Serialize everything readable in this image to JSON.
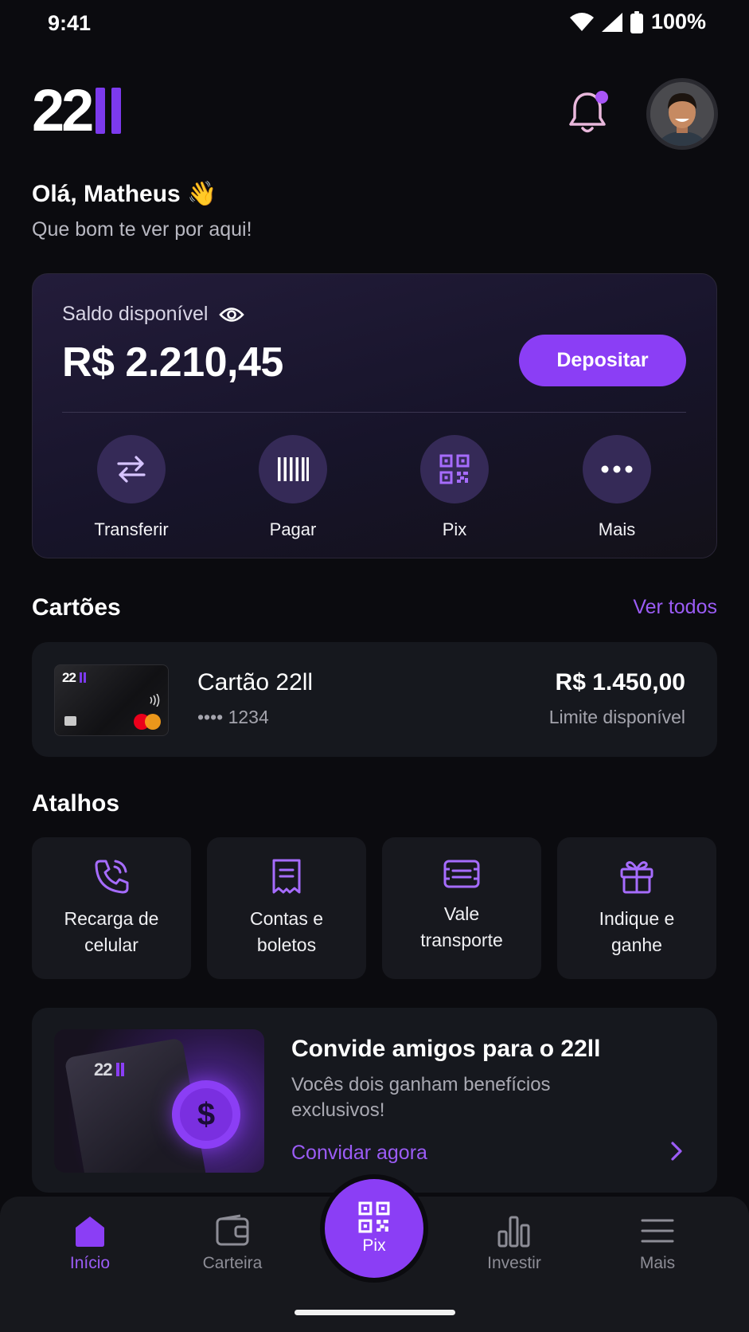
{
  "status_bar": {
    "time": "9:41",
    "battery": "100%"
  },
  "header": {
    "logo_text": "22",
    "greeting": "Olá, Matheus",
    "greeting_emoji": "👋",
    "subtitle": "Que bom te ver por aqui!"
  },
  "balance": {
    "label": "Saldo disponível",
    "value": "R$ 2.210,45",
    "deposit_label": "Depositar",
    "actions": [
      {
        "label": "Transferir",
        "icon": "transfer-icon"
      },
      {
        "label": "Pagar",
        "icon": "barcode-icon"
      },
      {
        "label": "Pix",
        "icon": "qr-code-icon"
      },
      {
        "label": "Mais",
        "icon": "more-dots-icon"
      }
    ]
  },
  "cards": {
    "title": "Cartões",
    "see_all": "Ver todos",
    "card": {
      "brand_text": "22",
      "name": "Cartão 22ll",
      "number": "•••• 1234",
      "amount": "R$ 1.450,00",
      "limit_label": "Limite disponível"
    }
  },
  "shortcuts": {
    "title": "Atalhos",
    "items": [
      {
        "label": "Recarga de\ncelular",
        "icon": "phone-icon"
      },
      {
        "label": "Contas e\nboletos",
        "icon": "receipt-icon"
      },
      {
        "label": "Vale\ntransporte",
        "icon": "ticket-icon"
      },
      {
        "label": "Indique e\nganhe",
        "icon": "gift-icon"
      }
    ]
  },
  "promo": {
    "title": "Convide amigos para o 22ll",
    "description": "Vocês dois ganham benefícios exclusivos!",
    "link": "Convidar agora",
    "image_brand": "22"
  },
  "bottom_nav": {
    "items": [
      {
        "label": "Início",
        "icon": "home-icon",
        "active": true
      },
      {
        "label": "Carteira",
        "icon": "wallet-icon",
        "active": false
      },
      {
        "label": "Pix",
        "icon": "qr-code-icon",
        "active": false
      },
      {
        "label": "Investir",
        "icon": "bar-chart-icon",
        "active": false
      },
      {
        "label": "Mais",
        "icon": "menu-icon",
        "active": false
      }
    ]
  },
  "colors": {
    "background": "#0b0b0f",
    "accent": "#8b3ef5",
    "accent_text": "#9b5cf6",
    "surface": "#16181e",
    "action_circle": "#352a57"
  }
}
